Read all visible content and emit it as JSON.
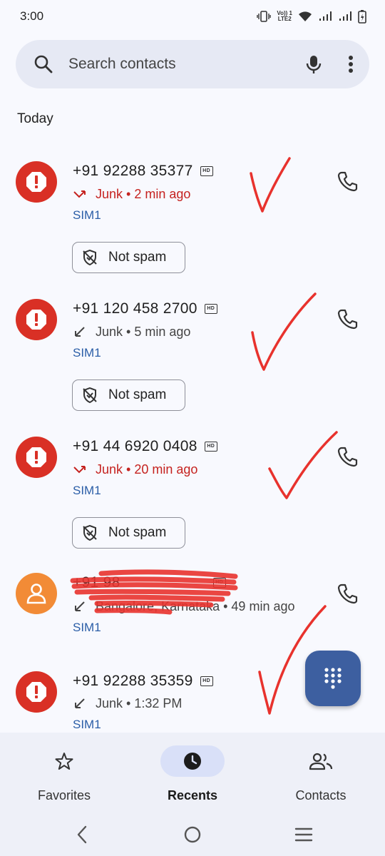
{
  "status_bar": {
    "time": "3:00",
    "network_label_top": "Vo)) 1",
    "network_label_bottom": "LTE2"
  },
  "search": {
    "placeholder": "Search contacts"
  },
  "section_header": "Today",
  "calls": [
    {
      "number": "+91 92288 35377",
      "hd": "HD",
      "call_type": "missed",
      "detail": "Junk • 2 min ago",
      "sim": "SIM1",
      "spam": true,
      "not_spam_label": "Not spam"
    },
    {
      "number": "+91 120 458 2700",
      "hd": "HD",
      "call_type": "incoming",
      "detail": "Junk • 5 min ago",
      "sim": "SIM1",
      "spam": true,
      "not_spam_label": "Not spam"
    },
    {
      "number": "+91 44 6920 0408",
      "hd": "HD",
      "call_type": "missed",
      "detail": "Junk • 20 min ago",
      "sim": "SIM1",
      "spam": true,
      "not_spam_label": "Not spam"
    },
    {
      "number": "+91 98",
      "hd": "HD",
      "call_type": "incoming",
      "detail": "Bangalore, Karnataka • 49 min ago",
      "sim": "SIM1",
      "spam": false
    },
    {
      "number": "+91 92288 35359",
      "hd": "HD",
      "call_type": "incoming",
      "detail": "Junk • 1:32 PM",
      "sim": "SIM1",
      "spam": true
    }
  ],
  "bottom_nav": {
    "items": [
      {
        "label": "Favorites",
        "icon": "star-icon",
        "active": false
      },
      {
        "label": "Recents",
        "icon": "clock-icon",
        "active": true
      },
      {
        "label": "Contacts",
        "icon": "people-icon",
        "active": false
      }
    ]
  },
  "colors": {
    "spam_red": "#d93025",
    "missed_red": "#c5221f",
    "sim_blue": "#2b5ea7",
    "fab_blue": "#3d5fa0",
    "annotation_red": "#e8322d",
    "avatar_orange": "#f28b36"
  }
}
